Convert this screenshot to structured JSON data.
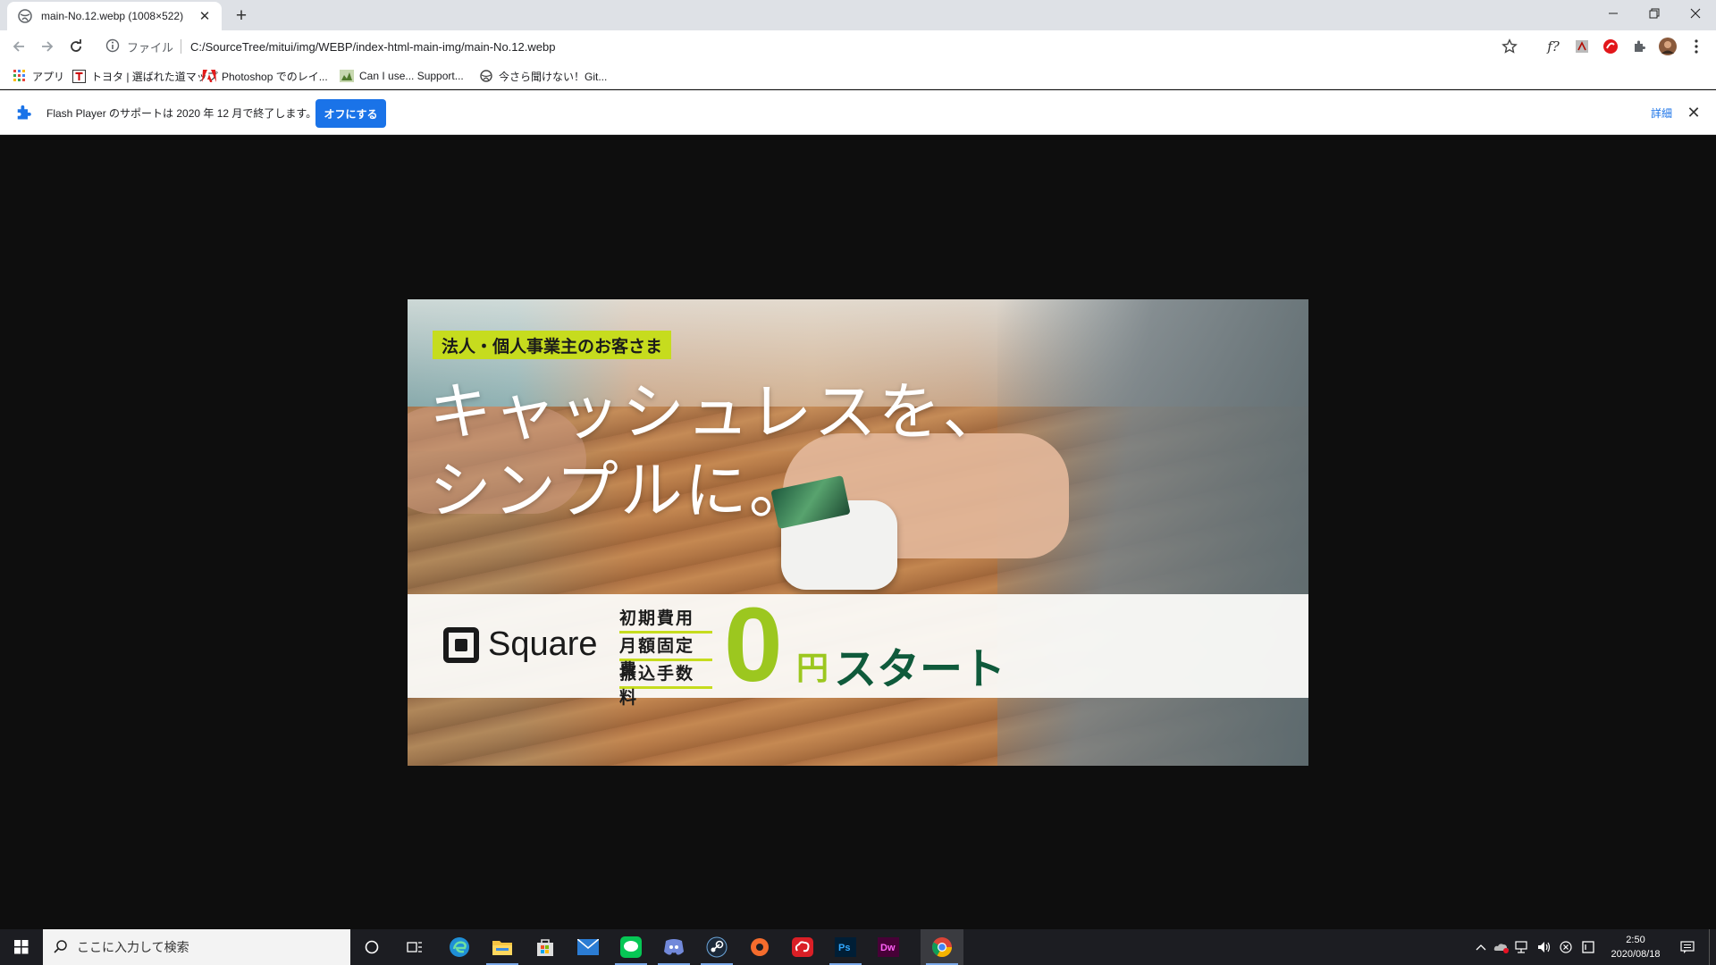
{
  "browser": {
    "tab": {
      "title": "main-No.12.webp (1008×522)"
    },
    "address": {
      "scheme_label": "ファイル",
      "url": "C:/SourceTree/mitui/img/WEBP/index-html-main-img/main-No.12.webp"
    },
    "bookmarks": [
      {
        "label": "アプリ",
        "icon": "apps-grid-icon"
      },
      {
        "label": "トヨタ | 選ばれた道マップ",
        "icon": "t-logo-icon"
      },
      {
        "label": "Photoshop でのレイ...",
        "icon": "adobe-icon"
      },
      {
        "label": "Can I use... Support...",
        "icon": "caniuse-icon"
      },
      {
        "label": "今さら聞けない！Git...",
        "icon": "globe-icon"
      }
    ],
    "infobar": {
      "message": "Flash Player のサポートは 2020 年 12 月で終了します。",
      "button_label": "オフにする",
      "link_label": "詳細"
    },
    "extensions_label_f": "f?"
  },
  "banner": {
    "tag": "法人・個人事業主のお客さま",
    "headline_line1": "キャッシュレスを、",
    "headline_line2": "シンプルに。",
    "brand": "Square",
    "fees": [
      "初期費用",
      "月額固定費",
      "振込手数料"
    ],
    "zero": "0",
    "yen": "円",
    "start": "スタート",
    "colors": {
      "accent_lime": "#c6dc1e",
      "zero_green": "#9cc71f",
      "dark_green": "#0f5a3b"
    }
  },
  "taskbar": {
    "search_placeholder": "ここに入力して検索",
    "apps": [
      "edge-icon",
      "file-explorer-icon",
      "store-icon",
      "mail-icon",
      "line-icon",
      "discord-icon",
      "steam-icon",
      "origin-icon",
      "creative-cloud-icon",
      "photoshop-icon",
      "dreamweaver-icon",
      "chrome-icon"
    ],
    "ps_label": "Ps",
    "dw_label": "Dw",
    "time": "2:50",
    "date": "2020/08/18"
  }
}
